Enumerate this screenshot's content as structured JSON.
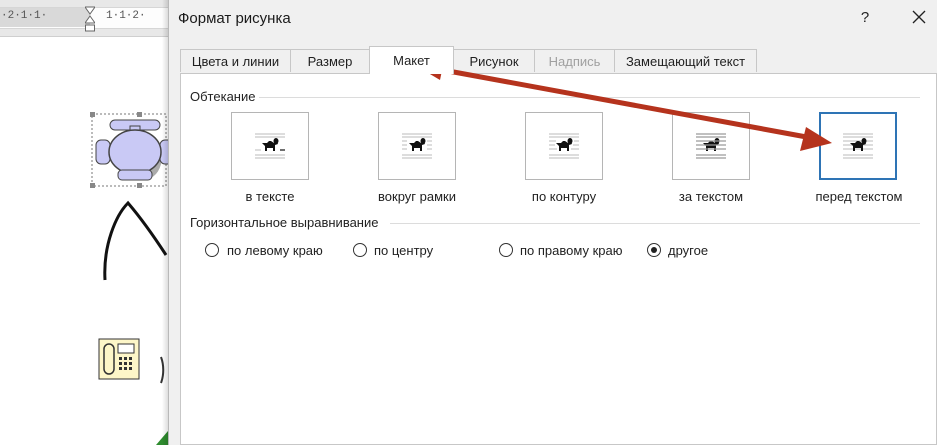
{
  "ruler": {
    "text_left": "·2·1·1·",
    "text_right": "1·1·2·"
  },
  "dialog": {
    "title": "Формат рисунка",
    "help": "?",
    "tabs": [
      {
        "label": "Цвета и линии",
        "state": "normal"
      },
      {
        "label": "Размер",
        "state": "normal"
      },
      {
        "label": "Макет",
        "state": "active"
      },
      {
        "label": "Рисунок",
        "state": "normal"
      },
      {
        "label": "Надпись",
        "state": "disabled"
      },
      {
        "label": "Замещающий текст",
        "state": "normal"
      }
    ],
    "wrapping": {
      "label": "Обтекание",
      "options": [
        {
          "label": "в тексте",
          "icon": "inline-dog-icon",
          "selected": false
        },
        {
          "label": "вокруг рамки",
          "icon": "square-wrap-dog-icon",
          "selected": false
        },
        {
          "label": "по контуру",
          "icon": "tight-wrap-dog-icon",
          "selected": false
        },
        {
          "label": "за текстом",
          "icon": "behind-text-dog-icon",
          "selected": false
        },
        {
          "label": "перед текстом",
          "icon": "in-front-dog-icon",
          "selected": true
        }
      ]
    },
    "horizontal_alignment": {
      "label": "Горизонтальное выравнивание",
      "options": [
        {
          "label": "по левому краю",
          "checked": false
        },
        {
          "label": "по центру",
          "checked": false
        },
        {
          "label": "по правому краю",
          "checked": false
        },
        {
          "label": "другое",
          "checked": true
        }
      ]
    }
  },
  "colors": {
    "accent": "#2e74b5",
    "arrow": "#b5331d"
  }
}
